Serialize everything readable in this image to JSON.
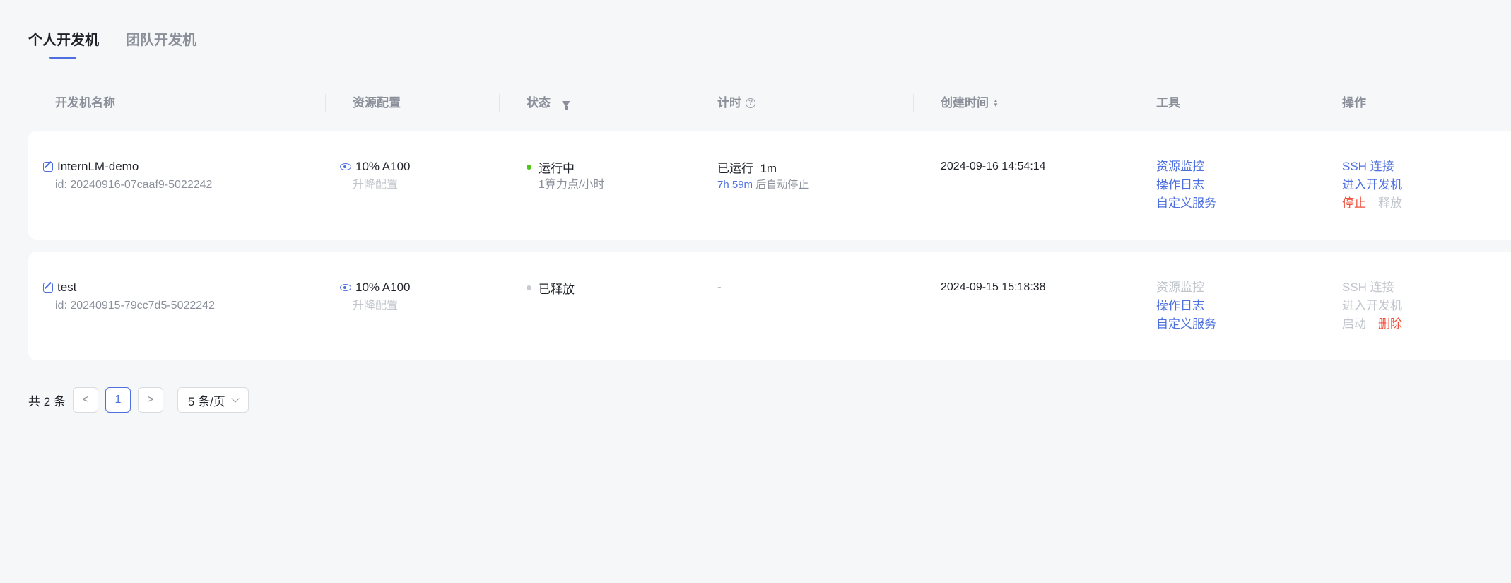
{
  "tabs": [
    {
      "label": "个人开发机",
      "active": true
    },
    {
      "label": "团队开发机",
      "active": false
    }
  ],
  "columns": [
    "开发机名称",
    "资源配置",
    "状态",
    "计时",
    "创建时间",
    "工具",
    "操作"
  ],
  "rows": [
    {
      "name": "InternLM-demo",
      "id": "id: 20240916-07caaf9-5022242",
      "resource": "10% A100",
      "resource_action": "升降配置",
      "status": "运行中",
      "status_color": "#52c41a",
      "status_sub": "1算力点/小时",
      "timer": "已运行  1m",
      "timer_highlight": "7h 59m",
      "timer_suffix": "后自动停止",
      "created": "2024-09-16 14:54:14",
      "tools": [
        "资源监控",
        "操作日志",
        "自定义服务"
      ],
      "ssh": "SSH 连接",
      "enter": "进入开发机",
      "op_a": "停止",
      "op_b": "释放"
    },
    {
      "name": "test",
      "id": "id: 20240915-79cc7d5-5022242",
      "resource": "10% A100",
      "resource_action": "升降配置",
      "status": "已释放",
      "status_color": "#c8ccd2",
      "status_sub": "",
      "timer": "-",
      "timer_highlight": "",
      "timer_suffix": "",
      "created": "2024-09-15 15:18:38",
      "tools": [
        "资源监控",
        "操作日志",
        "自定义服务"
      ],
      "ssh": "SSH 连接",
      "enter": "进入开发机",
      "op_a": "启动",
      "op_b": "删除"
    }
  ],
  "pagination": {
    "total": "共 2 条",
    "prev": "<",
    "page": "1",
    "next": ">",
    "page_size": "5 条/页"
  }
}
